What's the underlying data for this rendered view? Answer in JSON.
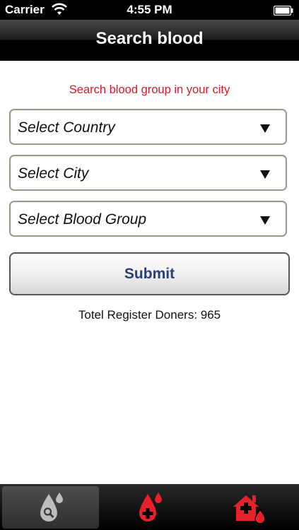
{
  "status_bar": {
    "carrier": "Carrier",
    "time": "4:55 PM"
  },
  "nav": {
    "title": "Search blood"
  },
  "main": {
    "subtitle": "Search blood group in your city",
    "selects": [
      {
        "label": "Select Country"
      },
      {
        "label": "Select City"
      },
      {
        "label": "Select Blood Group"
      }
    ],
    "submit_label": "Submit",
    "donor_count": "Totel Register Doners: 965"
  },
  "tab_bar": {
    "tabs": [
      {
        "icon": "search-blood-drop-icon",
        "active": true
      },
      {
        "icon": "add-blood-drop-icon",
        "active": false
      },
      {
        "icon": "blood-bank-home-icon",
        "active": false
      }
    ]
  },
  "colors": {
    "accent_red": "#d7192c",
    "submit_text": "#2c3e7a",
    "tab_icon_red": "#e8202a"
  }
}
